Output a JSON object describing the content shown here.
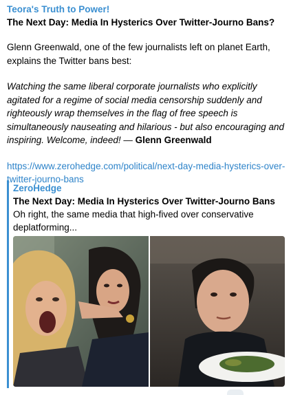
{
  "message": {
    "channel_name": "Teora's Truth to Power!",
    "headline": "The Next Day: Media In Hysterics Over Twitter-Journo Bans?",
    "intro": "Glenn Greenwald, one of the few journalists left on planet Earth, explains the Twitter bans best:",
    "quote": "Watching the same liberal corporate journalists who explicitly agitated for a regime of social media censorship suddenly and righteously wrap themselves in the flag of free speech is simultaneously nauseating and hilarious - but also encouraging and inspiring. Welcome, indeed! —",
    "quote_author": "Glenn Greenwald",
    "link": "https://www.zerohedge.com/political/next-day-media-hysterics-over-twitter-journo-bans"
  },
  "link_preview": {
    "site_name": "ZeroHedge",
    "title": "The Next Day: Media In Hysterics Over Twitter-Journo Bans",
    "description": "Oh right, the same media that high-fived over conservative deplatforming...",
    "image_icon": "woman-yelling-at-cat-meme-image"
  },
  "colors": {
    "accent": "#3a8fd1",
    "link": "#2d83c9",
    "background": "#ffffff"
  }
}
